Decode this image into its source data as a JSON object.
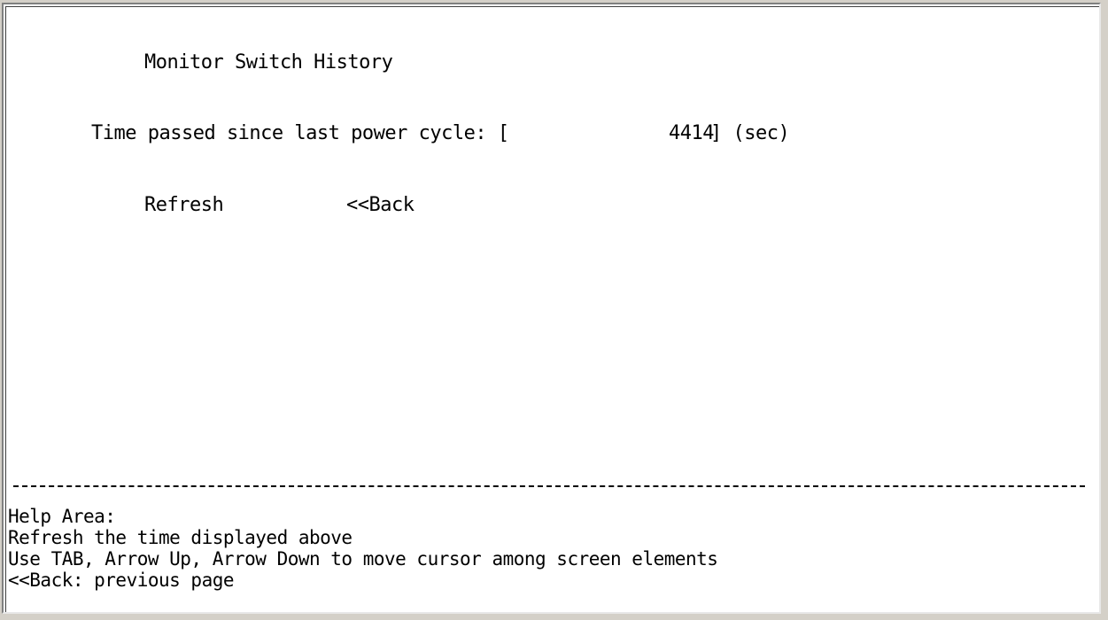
{
  "page": {
    "title": "Monitor Switch History",
    "time_label": "Time passed since last power cycle: [",
    "time_value": "4414",
    "time_suffix": "] (sec)"
  },
  "buttons": {
    "refresh": "Refresh",
    "back": "<<Back"
  },
  "help": {
    "heading": "Help Area:",
    "lines": [
      "Refresh the time displayed above",
      "Use TAB, Arrow Up, Arrow Down to move cursor among screen elements",
      "<<Back: previous page"
    ]
  }
}
